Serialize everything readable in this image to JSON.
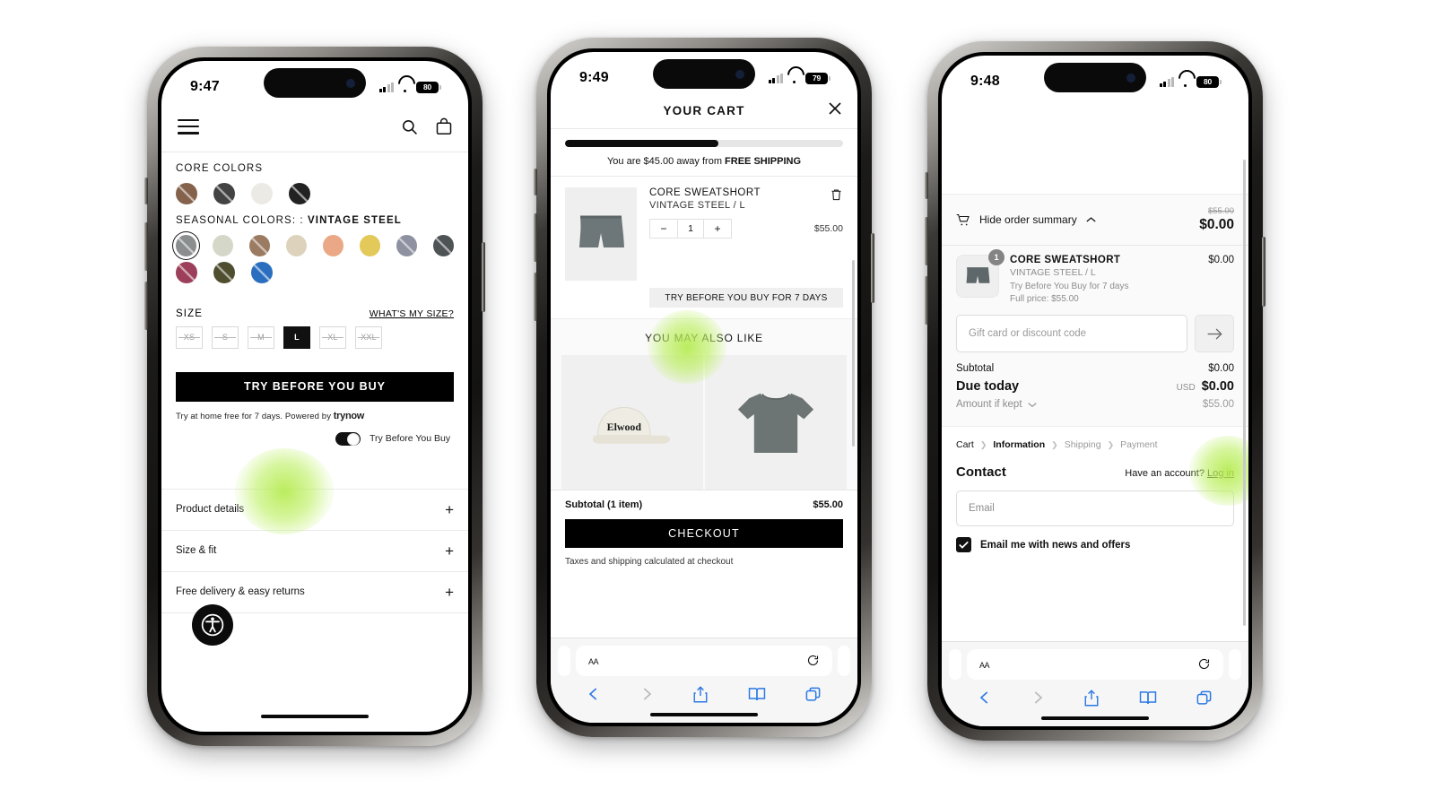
{
  "phones": [
    {
      "id": "pdp",
      "status": {
        "time": "9:47",
        "battery": "80"
      },
      "header": {
        "menu_icon": "hamburger-icon",
        "search_icon": "search-icon",
        "bag_icon": "shopping-bag-icon"
      },
      "core_colors": {
        "label": "CORE COLORS",
        "swatches": [
          {
            "name": "brown",
            "hex": "#84624b"
          },
          {
            "name": "charcoal",
            "hex": "#434343"
          },
          {
            "name": "off-white",
            "hex": "#eceae5"
          },
          {
            "name": "black",
            "hex": "#222222"
          }
        ]
      },
      "seasonal_colors": {
        "label_prefix": "SEASONAL COLORS: :",
        "selected_name": "VINTAGE STEEL",
        "swatches": [
          {
            "name": "vintage-steel",
            "hex": "#8b8e8e",
            "selected": true
          },
          {
            "name": "pale-sage",
            "hex": "#d5d7c9"
          },
          {
            "name": "taupe",
            "hex": "#9b7b61"
          },
          {
            "name": "sand",
            "hex": "#ddd2bb"
          },
          {
            "name": "peach",
            "hex": "#eba886"
          },
          {
            "name": "mustard",
            "hex": "#e3c85a"
          },
          {
            "name": "slate",
            "hex": "#8d91a0"
          },
          {
            "name": "dark-slate",
            "hex": "#4e5355"
          },
          {
            "name": "wine",
            "hex": "#9c3f5b"
          },
          {
            "name": "olive",
            "hex": "#4f4f2f"
          },
          {
            "name": "cobalt",
            "hex": "#2a6fbf"
          }
        ]
      },
      "size": {
        "label": "SIZE",
        "guide_link": "WHAT'S MY SIZE?",
        "options": [
          {
            "label": "XS",
            "state": "unavailable"
          },
          {
            "label": "S",
            "state": "unavailable"
          },
          {
            "label": "M",
            "state": "unavailable"
          },
          {
            "label": "L",
            "state": "selected"
          },
          {
            "label": "XL",
            "state": "unavailable"
          },
          {
            "label": "XXL",
            "state": "unavailable"
          }
        ]
      },
      "cta_label": "TRY BEFORE YOU BUY",
      "powered_text": "Try at home free for 7 days. Powered by",
      "powered_brand": "trynow",
      "toggle": {
        "label": "Try Before You Buy",
        "on": true
      },
      "accordion": [
        {
          "label": "Product details",
          "icon": "plus-icon"
        },
        {
          "label": "Size & fit",
          "icon": "plus-icon"
        },
        {
          "label": "Free delivery & easy returns",
          "icon": "plus-icon"
        }
      ],
      "accessibility_icon": "accessibility-icon"
    },
    {
      "id": "cart",
      "status": {
        "time": "9:49",
        "battery": "79"
      },
      "title": "YOUR CART",
      "close_icon": "close-icon",
      "shipping": {
        "progress_pct": 55,
        "text_prefix": "You are $45.00 away from",
        "text_bold": "FREE SHIPPING"
      },
      "item": {
        "name": "CORE SWEATSHORT",
        "variant": "VINTAGE STEEL / L",
        "qty": "1",
        "price": "$55.00",
        "minus": "−",
        "plus": "+",
        "trash_icon": "trash-icon",
        "tbyb_banner": "TRY BEFORE YOU BUY FOR 7 DAYS"
      },
      "recommendations": {
        "title": "YOU MAY ALSO LIKE",
        "items": [
          {
            "name": "elwood-cap",
            "label": "Elwood"
          },
          {
            "name": "grey-baby-tee",
            "label": ""
          }
        ]
      },
      "footer": {
        "subtotal_label": "Subtotal (1 item)",
        "subtotal_value": "$55.00",
        "checkout_label": "CHECKOUT",
        "tax_note": "Taxes and shipping calculated at checkout"
      },
      "safari": {
        "aa": "AA",
        "reload_icon": "reload-icon",
        "back_icon": "back-icon",
        "forward_icon": "forward-icon",
        "share_icon": "share-icon",
        "bookmarks_icon": "bookmarks-icon",
        "tabs_icon": "tabs-icon"
      }
    },
    {
      "id": "checkout",
      "status": {
        "time": "9:48",
        "battery": "80"
      },
      "summary": {
        "toggle_label": "Hide order summary",
        "cart_icon": "cart-icon",
        "chevron_icon": "chevron-up-icon",
        "strike_total": "$55.00",
        "total": "$0.00"
      },
      "line_item": {
        "badge": "1",
        "name": "CORE SWEATSHORT",
        "variant": "VINTAGE STEEL / L",
        "tbyb_note": "Try Before You Buy for 7 days",
        "full_price": "Full price: $55.00",
        "price": "$0.00"
      },
      "gift_card": {
        "placeholder": "Gift card or discount code",
        "submit_icon": "arrow-right-icon"
      },
      "totals": [
        {
          "label": "Subtotal",
          "value": "$0.00",
          "style": "normal"
        },
        {
          "label": "Due today",
          "value": "$0.00",
          "currency": "USD",
          "style": "bold"
        },
        {
          "label": "Amount if kept",
          "value": "$55.00",
          "style": "muted",
          "icon": "chevron-down-icon"
        }
      ],
      "breadcrumbs": [
        "Cart",
        "Information",
        "Shipping",
        "Payment"
      ],
      "breadcrumb_current_index": 1,
      "contact": {
        "title": "Contact",
        "account_text": "Have an account?",
        "login_link": "Log in",
        "email_placeholder": "Email",
        "newsletter_label": "Email me with news and offers",
        "newsletter_checked": true,
        "check_icon": "check-icon"
      },
      "safari": {
        "aa": "AA",
        "reload_icon": "reload-icon",
        "back_icon": "back-icon",
        "forward_icon": "forward-icon",
        "share_icon": "share-icon",
        "bookmarks_icon": "bookmarks-icon",
        "tabs_icon": "tabs-icon"
      }
    }
  ],
  "colors": {
    "accent_glow": "#b5eb50",
    "cta_black": "#000000",
    "muted_text": "#8d8d8d"
  }
}
